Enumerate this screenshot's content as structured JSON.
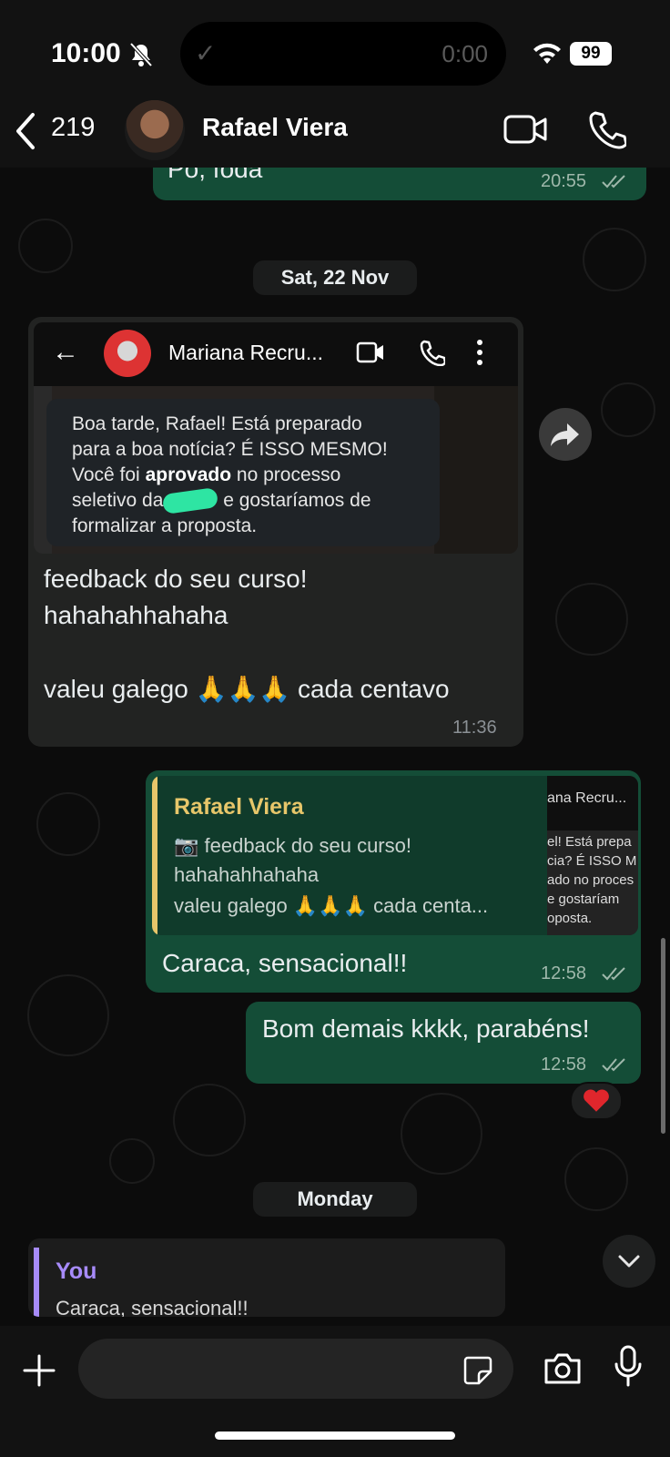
{
  "status_bar": {
    "time": "10:00",
    "activity_time": "0:00",
    "battery": "99"
  },
  "header": {
    "back_count": "219",
    "contact_name": "Rafael Viera"
  },
  "messages": {
    "top_partial": {
      "text": "Po, foda",
      "time": "20:55"
    },
    "date_sep_1": "Sat, 22 Nov",
    "screenshot": {
      "contact": "Mariana Recru...",
      "line1": "Boa tarde, Rafael! Está preparado",
      "line2": "para a boa notícia? É ISSO MESMO!",
      "line3_pre": "Você foi ",
      "line3_bold": "aprovado",
      "line3_post": " no processo",
      "line4_pre": "seletivo da",
      "line4_post": " e gostaríamos de",
      "line5": "formalizar a proposta."
    },
    "incoming": {
      "line1": "feedback do seu curso!",
      "line2": "hahahahhahaha",
      "line3": "valeu galego 🙏🙏🙏 cada centavo",
      "time": "11:36"
    },
    "reply": {
      "quote_name": "Rafael Viera",
      "quote_line1": "📷 feedback do seu curso!",
      "quote_line2": "hahahahhahaha",
      "quote_line3": "valeu galego 🙏🙏🙏 cada centa...",
      "thumb_name": "ana Recru...",
      "thumb_l1": "el! Está prepa",
      "thumb_l2": "cia? É ISSO M",
      "thumb_l3": "ado no proces",
      "thumb_l4": " e gostaríam",
      "thumb_l5": "oposta.",
      "text": "Caraca, sensacional!!",
      "time": "12:58"
    },
    "outgoing2": {
      "text": "Bom demais kkkk, parabéns!",
      "time": "12:58",
      "reaction": "❤️"
    },
    "date_sep_2": "Monday"
  },
  "reply_draft": {
    "name": "You",
    "text": "Caraca, sensacional!!"
  },
  "input": {
    "placeholder": ""
  },
  "colors": {
    "outgoing_bubble": "#144d37",
    "incoming_bubble": "#222322",
    "quote_name": "#e7c66a",
    "you_name": "#a78bfa"
  }
}
